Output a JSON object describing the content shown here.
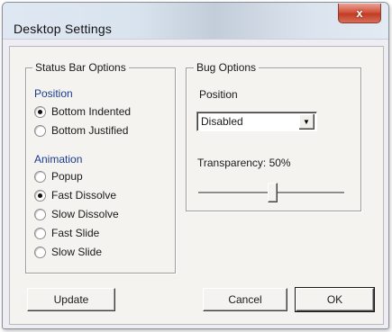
{
  "window": {
    "title": "Desktop Settings",
    "close_glyph": "x"
  },
  "status_bar_options": {
    "legend": "Status Bar Options",
    "position_label": "Position",
    "position_options": [
      {
        "label": "Bottom Indented",
        "checked": true
      },
      {
        "label": "Bottom Justified",
        "checked": false
      }
    ],
    "animation_label": "Animation",
    "animation_options": [
      {
        "label": "Popup",
        "checked": false
      },
      {
        "label": "Fast Dissolve",
        "checked": true
      },
      {
        "label": "Slow Dissolve",
        "checked": false
      },
      {
        "label": "Fast Slide",
        "checked": false
      },
      {
        "label": "Slow Slide",
        "checked": false
      }
    ]
  },
  "bug_options": {
    "legend": "Bug Options",
    "position_label": "Position",
    "position_value": "Disabled",
    "transparency_label": "Transparency: 50%",
    "transparency_value": 0.5
  },
  "buttons": {
    "update": "Update",
    "cancel": "Cancel",
    "ok": "OK"
  },
  "colors": {
    "section_label": "#1c3b8f",
    "close_button": "#c23b22"
  }
}
